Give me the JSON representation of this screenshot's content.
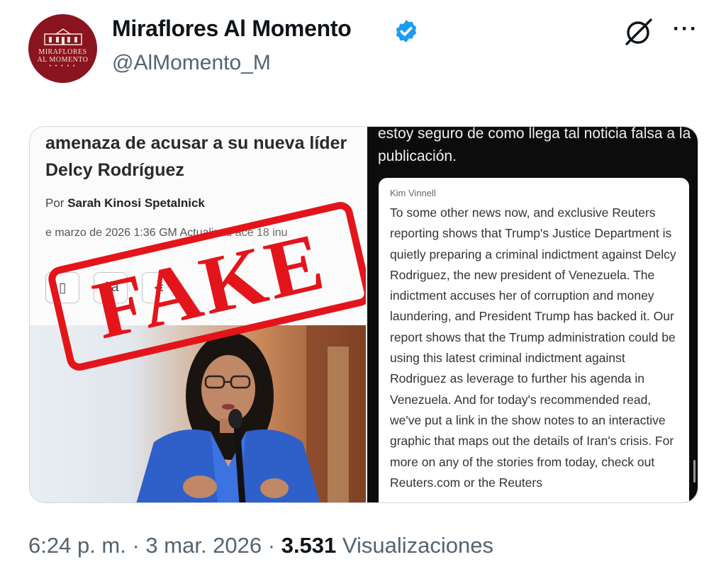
{
  "author": {
    "display_name": "Miraflores Al Momento",
    "handle": "@AlMomento_M",
    "avatar_text": [
      "MIRAFLORES",
      "AL MOMENTO"
    ],
    "verified": true
  },
  "header_actions": {
    "grok_icon": "grok-icon",
    "more_label": "···"
  },
  "media": {
    "left": {
      "headline": "amenaza de acusar a su nueva líder Delcy Rodríguez",
      "byline_prefix": "Por ",
      "byline_names": "Sarah Kinosi             Spetalnick",
      "dateline": "   e marzo de 2026  1:36 GM        Actualizad      ace 18 inu",
      "tools": [
        "",
        "Aa",
        ""
      ],
      "stamp": "FAKE"
    },
    "right": {
      "top_text": "estoy seguro de como llega tal noticia falsa a la publicación.",
      "speaker": "Kim Vinnell",
      "transcript": "To some other news now, and exclusive Reuters reporting shows that Trump's Justice Department is quietly preparing a criminal indictment against Delcy Rodriguez, the new president of Venezuela. The indictment accuses her of corruption and money laundering, and President Trump has backed it. Our report shows that the Trump administration could be using this latest criminal indictment against Rodriguez as leverage to further his agenda in Venezuela. And for today's recommended read, we've put a link in the show notes to an interactive graphic that maps out the details of Iran's crisis. For more on any of the stories from today, check out Reuters.com or the Reuters"
    }
  },
  "meta": {
    "time": "6:24 p. m.",
    "sep1": " · ",
    "date": "3 mar. 2026",
    "sep2": " · ",
    "views": "3.531",
    "views_label": " Visualizaciones"
  },
  "colors": {
    "brand": "#8a1420",
    "verified": "#1d9bf0",
    "stamp": "#e3151b"
  }
}
